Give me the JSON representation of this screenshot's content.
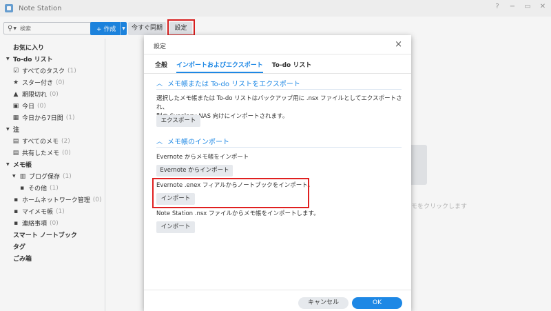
{
  "app": {
    "title": "Note Station",
    "window_controls": [
      "?",
      "−",
      "▭",
      "✕"
    ]
  },
  "toolbar": {
    "search_placeholder": "検索",
    "create_label": "+ 作成",
    "sync_label": "今すぐ同期",
    "settings_label": "設定"
  },
  "sidebar": {
    "favorites": "お気に入り",
    "todo_header": "To-do リスト",
    "todo_items": [
      {
        "label": "すべてのタスク",
        "count": "(1)"
      },
      {
        "label": "スター付き",
        "count": "(0)"
      },
      {
        "label": "期限切れ",
        "count": "(0)"
      },
      {
        "label": "今日",
        "count": "(0)"
      },
      {
        "label": "今日から7日間",
        "count": "(1)"
      }
    ],
    "notes_header": "注",
    "notes_items": [
      {
        "label": "すべてのメモ",
        "count": "(2)"
      },
      {
        "label": "共有したメモ",
        "count": "(0)"
      }
    ],
    "notebook_header": "メモ帳",
    "notebook_group": {
      "label": "ブログ保存",
      "count": "(1)"
    },
    "notebook_sub": {
      "label": "その他",
      "count": "(1)"
    },
    "notebook_items": [
      {
        "label": "ホームネットワーク管理",
        "count": "(0)"
      },
      {
        "label": "マイメモ帳",
        "count": "(1)"
      },
      {
        "label": "連絡事項",
        "count": "(0)"
      }
    ],
    "smart_notebook": "スマート ノートブック",
    "tags": "タグ",
    "trash": "ごみ箱"
  },
  "main": {
    "hint": "モをクリックします"
  },
  "dialog": {
    "title": "設定",
    "close": "×",
    "tabs": [
      "全般",
      "インポートおよびエクスポート",
      "To-do リスト"
    ],
    "active_tab": 1,
    "export_section": {
      "heading": "メモ帳または To-do リストをエクスポート",
      "desc_line1": "選択したメモ帳または To-do リストはバックアップ用に .nsx ファイルとしてエクスポートされ、",
      "desc_line2": "別の Synology NAS 向けにインポートされます。",
      "button": "エクスポート"
    },
    "import_section": {
      "heading": "メモ帳のインポート",
      "evernote_desc": "Evernote からメモ帳をインポート",
      "evernote_button": "Evernote からインポート",
      "enex_desc": "Evernote .enex フィアルからノートブックをインポート。",
      "enex_button": "インポート",
      "nsx_desc": "Note Station .nsx ファイルからメモ帳をインポートします。",
      "nsx_button": "インポート"
    },
    "cancel": "キャンセル",
    "ok": "OK"
  },
  "colors": {
    "accent": "#1e88e5",
    "highlight": "#e02020"
  }
}
